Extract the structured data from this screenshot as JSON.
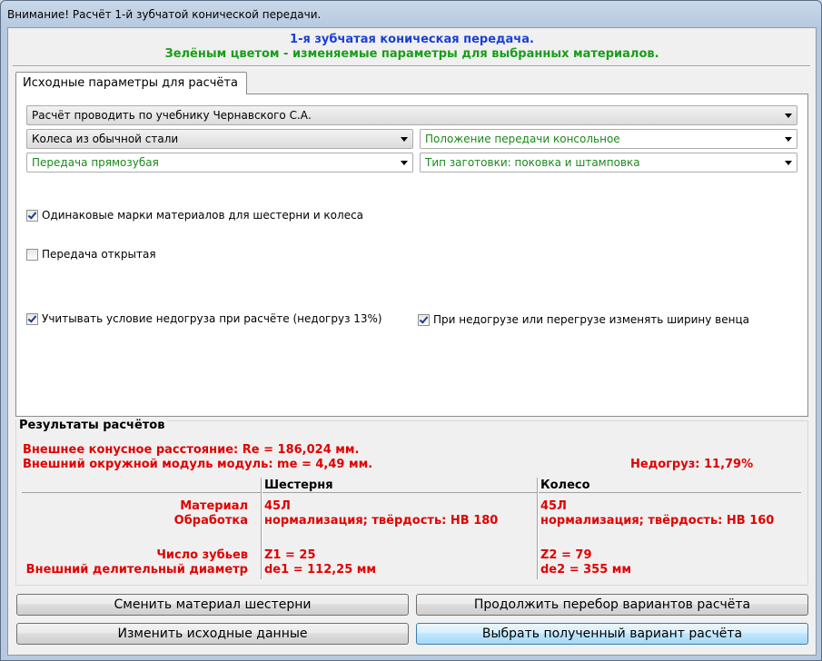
{
  "window": {
    "title": "Внимание! Расчёт 1-й зубчатой конической передачи."
  },
  "header": {
    "line1": "1-я зубчатая коническая передача.",
    "line2": "Зелёным цветом - изменяемые параметры для выбранных материалов."
  },
  "tab": {
    "label": "Исходные параметры для расчёта"
  },
  "combos": {
    "textbook": "Расчёт проводить по учебнику Чернавского С.А.",
    "steel": "Колеса из обычной стали",
    "position": "Положение передачи консольное",
    "gear_type": "Передача прямозубая",
    "blank": "Тип заготовки: поковка и штамповка"
  },
  "checkboxes": {
    "same_materials": {
      "label": "Одинаковые марки материалов для шестерни и колеса",
      "checked": true
    },
    "open_gear": {
      "label": "Передача открытая",
      "checked": false
    },
    "underload": {
      "label": "Учитывать условие недогруза при расчёте (недогруз 13%)",
      "checked": true
    },
    "change_width": {
      "label": "При недогрузе или перегрузе изменять ширину венца",
      "checked": true
    }
  },
  "results": {
    "title": "Результаты расчётов",
    "cone_distance": "Внешнее конусное расстояние:  Re = 186,024 мм.",
    "module": "Внешний окружной модуль модуль:  me = 4,49 мм.",
    "underload": "Недогруз: 11,79%",
    "col_pinion": "Шестерня",
    "col_wheel": "Колесо",
    "label_material": "Материал",
    "label_treatment": "Обработка",
    "label_teeth": "Число зубьев",
    "label_diameter": "Внешний делительный диаметр",
    "pinion": {
      "material": "45Л",
      "treatment": "нормализация;  твёрдость: НВ 180",
      "teeth": "Z1 = 25",
      "diameter": "de1 = 112,25 мм"
    },
    "wheel": {
      "material": "45Л",
      "treatment": "нормализация;  твёрдость: НВ 160",
      "teeth": "Z2 = 79",
      "diameter": "de2 = 355 мм"
    }
  },
  "buttons": {
    "change_material": "Сменить материал шестерни",
    "continue": "Продолжить перебор вариантов расчёта",
    "edit_input": "Изменить исходные данные",
    "choose": "Выбрать полученный вариант расчёта"
  },
  "colors": {
    "green": "#1a8a1a",
    "red": "#e00000",
    "blue": "#1a3fd6"
  }
}
